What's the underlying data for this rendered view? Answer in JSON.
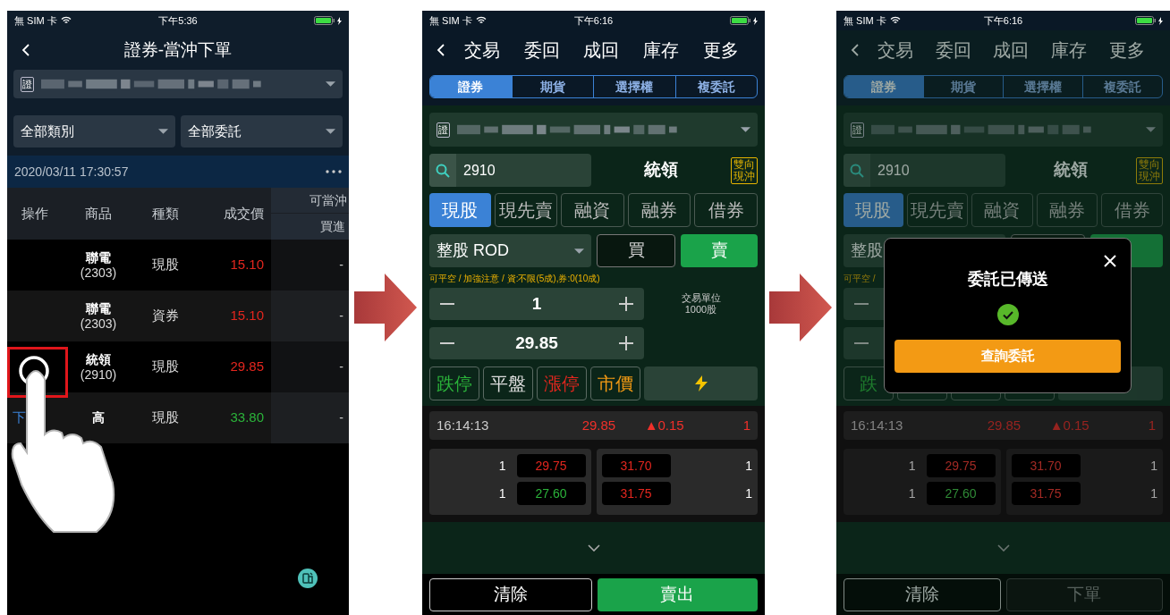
{
  "screens": [
    {
      "kind": "order_list",
      "status_bar": {
        "carrier": "無 SIM 卡",
        "time": "下午5:36"
      },
      "title": "證券-當沖下單",
      "account": {
        "badge": "證"
      },
      "filters": [
        "全部類別",
        "全部委託"
      ],
      "timestamp": "2020/03/11 17:30:57",
      "table": {
        "columns": [
          "操作",
          "商品",
          "種類",
          "成交價"
        ],
        "grouped_column": {
          "label": "可當沖",
          "sub_label": "買進"
        },
        "rows": [
          {
            "name": "聯電",
            "code": "(2303)",
            "type": "現股",
            "price": "15.10",
            "color": "#e3261e",
            "column_5": "-",
            "tapped": false
          },
          {
            "name": "聯電",
            "code": "(2303)",
            "type": "資券",
            "price": "15.10",
            "color": "#e3261e",
            "column_5": "-",
            "tapped": false
          },
          {
            "name": "統領",
            "code": "(2910)",
            "type": "現股",
            "price": "29.85",
            "color": "#e3261e",
            "column_5": "-",
            "tapped": true
          },
          {
            "action": "下",
            "name": "高",
            "type": "現股",
            "price": "33.80",
            "color": "#2bb33a",
            "column_5": "-",
            "tapped": false
          }
        ]
      }
    },
    {
      "kind": "order_entry",
      "status_bar": {
        "carrier": "無 SIM 卡",
        "time": "下午6:16"
      },
      "nav": [
        "交易",
        "委回",
        "成回",
        "庫存",
        "更多"
      ],
      "segments": [
        {
          "label": "證券",
          "selected": true
        },
        {
          "label": "期貨",
          "selected": false
        },
        {
          "label": "選擇權",
          "selected": false
        },
        {
          "label": "複委託",
          "selected": false
        }
      ],
      "account": {
        "badge": "證"
      },
      "search": {
        "value": "2910"
      },
      "stock_name": "統領",
      "badge": "雙向現沖",
      "market_tabs": [
        {
          "label": "現股",
          "selected": true
        },
        {
          "label": "現先賣",
          "selected": false
        },
        {
          "label": "融資",
          "selected": false
        },
        {
          "label": "融券",
          "selected": false
        },
        {
          "label": "借券",
          "selected": false
        }
      ],
      "order_type": "整股 ROD",
      "side": [
        {
          "label": "買",
          "selected": false
        },
        {
          "label": "賣",
          "selected": true
        }
      ],
      "notice": "可平空 / 加強注意 / 資:不限(5成),券:0(10成)",
      "quantity": {
        "value": "1"
      },
      "unit": {
        "label": "交易單位",
        "value": "1000股"
      },
      "price": {
        "value": "29.85"
      },
      "price_buttons": [
        {
          "label": "跌停",
          "kind": "limit_down"
        },
        {
          "label": "平盤",
          "kind": "flat"
        },
        {
          "label": "漲停",
          "kind": "limit_up"
        },
        {
          "label": "市價",
          "kind": "market"
        }
      ],
      "flash_button": true,
      "quote": {
        "time": "16:14:13",
        "price": "29.85",
        "change": "▲0.15",
        "volume": "1"
      },
      "order_book": {
        "bids": [
          {
            "qty": "1",
            "price": "29.75",
            "color": "#e3261e"
          },
          {
            "qty": "1",
            "price": "27.60",
            "color": "#2bb33a"
          }
        ],
        "asks": [
          {
            "price": "31.70",
            "color": "#e3261e",
            "qty": "1"
          },
          {
            "price": "31.75",
            "color": "#e3261e",
            "qty": "1"
          }
        ]
      },
      "actions": [
        {
          "label": "清除",
          "kind": "clear"
        },
        {
          "label": "賣出",
          "kind": "sell"
        }
      ]
    },
    {
      "kind": "order_entry",
      "status_bar": {
        "carrier": "無 SIM 卡",
        "time": "下午6:16"
      },
      "nav": [
        "交易",
        "委回",
        "成回",
        "庫存",
        "更多"
      ],
      "segments": [
        {
          "label": "證券",
          "selected": true
        },
        {
          "label": "期貨",
          "selected": false
        },
        {
          "label": "選擇權",
          "selected": false
        },
        {
          "label": "複委託",
          "selected": false
        }
      ],
      "account": {
        "badge": "證"
      },
      "search": {
        "value": "2910"
      },
      "stock_name": "統領",
      "badge": "雙向現沖",
      "market_tabs": [
        {
          "label": "現股",
          "selected": true
        },
        {
          "label": "現先賣",
          "selected": false
        },
        {
          "label": "融資",
          "selected": false
        },
        {
          "label": "融券",
          "selected": false
        },
        {
          "label": "借券",
          "selected": false
        }
      ],
      "order_type": "整股",
      "side": [
        {
          "selected": false
        },
        {
          "selected": true
        }
      ],
      "notice": "可平空 /",
      "price_buttons": [
        {
          "label": "跌",
          "kind": "limit_down"
        },
        {
          "kind": "flat"
        },
        {
          "kind": "limit_up"
        },
        {
          "kind": "market"
        }
      ],
      "flash_button": false,
      "quote": {
        "time": "16:14:13",
        "price": "29.85",
        "change": "▲0.15",
        "volume": "1"
      },
      "order_book": {
        "bids": [
          {
            "qty": "1",
            "price": "29.75",
            "color": "#a32a24"
          },
          {
            "qty": "1",
            "price": "27.60",
            "color": "#2f8a36"
          }
        ],
        "asks": [
          {
            "price": "31.70",
            "color": "#a32a24",
            "qty": "1"
          },
          {
            "price": "31.75",
            "color": "#a32a24",
            "qty": "1"
          }
        ]
      },
      "actions": [
        {
          "label": "清除",
          "kind": "clear"
        },
        {
          "label": "下單",
          "kind": "submit"
        }
      ],
      "dialog": {
        "title": "委託已傳送",
        "button": "查詢委託"
      }
    }
  ]
}
